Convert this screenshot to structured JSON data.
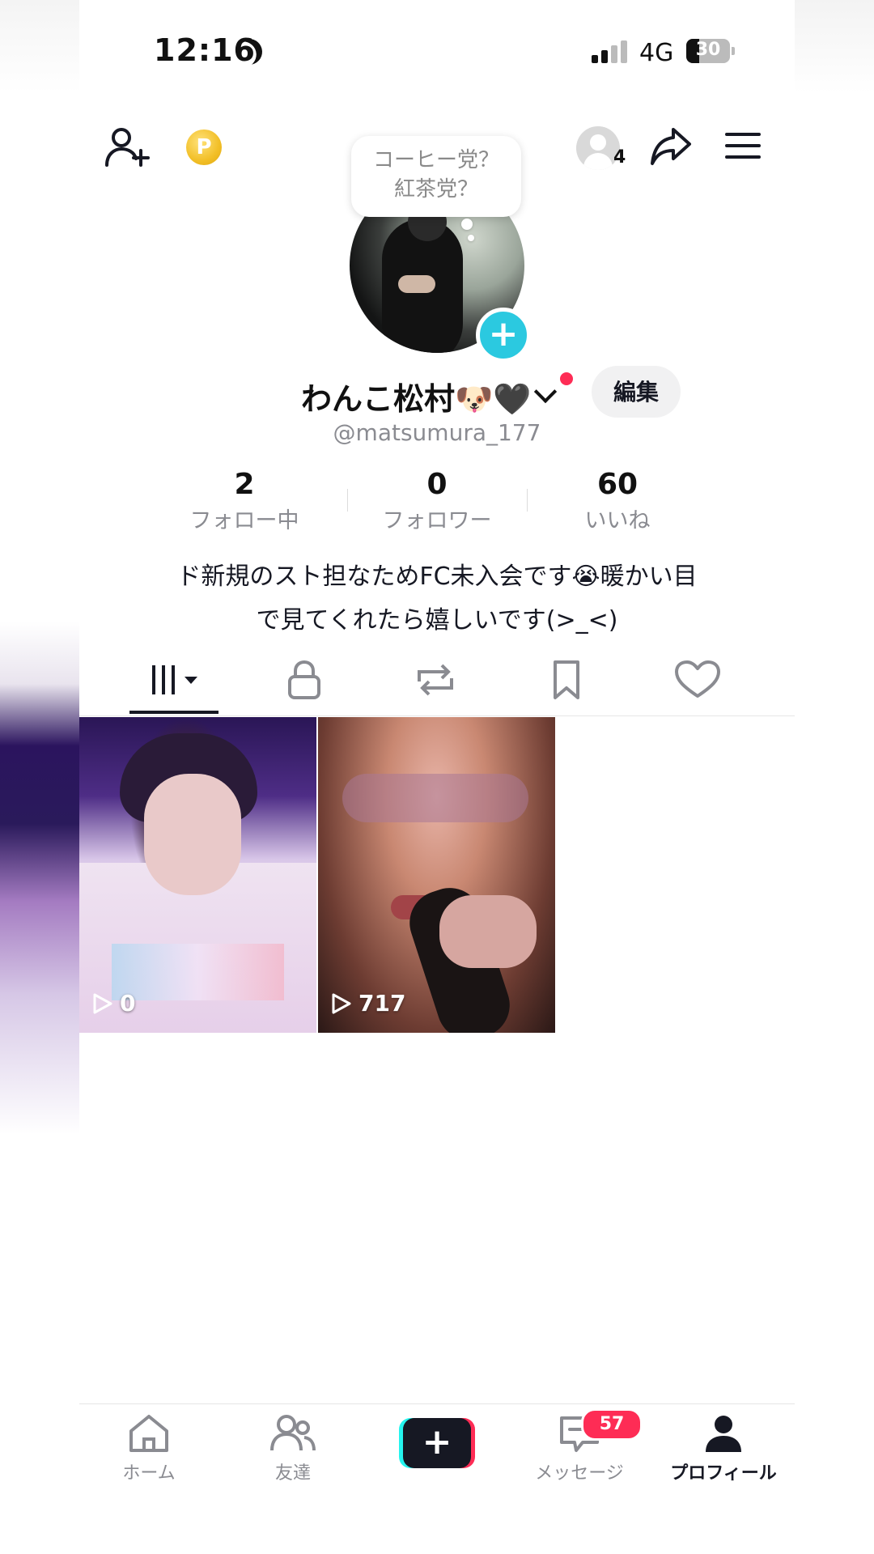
{
  "status_bar": {
    "time": "12:16",
    "network": "4G",
    "battery": "30",
    "battery_level": 0.3
  },
  "header": {
    "coin_label": "P",
    "viewer_count": "4"
  },
  "avatar_bubble": {
    "line1": "コーヒー党？",
    "line2": "紅茶党？"
  },
  "profile": {
    "name": "わんこ松村🐶🖤",
    "edit_label": "編集",
    "handle": "@matsumura_177",
    "bio_line1": "ド新規のスト担なためFC未入会です😭暖かい目",
    "bio_line2": "で見てくれたら嬉しいです(>_<)"
  },
  "stats": [
    {
      "value": "2",
      "label": "フォロー中"
    },
    {
      "value": "0",
      "label": "フォロワー"
    },
    {
      "value": "60",
      "label": "いいね"
    }
  ],
  "tabs": [
    "videos-grid-icon",
    "lock-icon",
    "repost-icon",
    "bookmark-icon",
    "heart-icon"
  ],
  "videos": [
    {
      "plays": "0"
    },
    {
      "plays": "717"
    }
  ],
  "bottom_nav": {
    "home": "ホーム",
    "friends": "友達",
    "create": "+",
    "messages": "メッセージ",
    "messages_badge": "57",
    "profile": "プロフィール"
  },
  "colors": {
    "accent": "#fe2c55",
    "cyan": "#25f4ee",
    "plus_blue": "#2bc9e0",
    "text": "#161823",
    "muted": "#8a8b91"
  }
}
